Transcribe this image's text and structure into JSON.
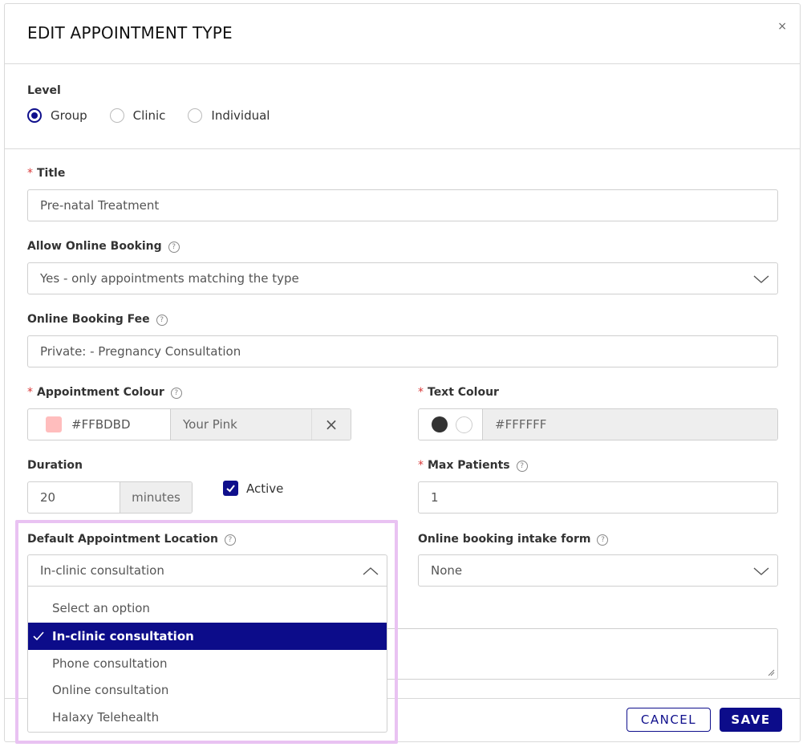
{
  "modal": {
    "title": "EDIT APPOINTMENT TYPE",
    "close": "×"
  },
  "level": {
    "label": "Level",
    "options": [
      {
        "label": "Group",
        "checked": true
      },
      {
        "label": "Clinic",
        "checked": false
      },
      {
        "label": "Individual",
        "checked": false
      }
    ]
  },
  "title_field": {
    "required": "*",
    "label": "Title",
    "value": "Pre-natal Treatment"
  },
  "online_booking": {
    "label": "Allow Online Booking",
    "value": "Yes - only appointments matching the type"
  },
  "booking_fee": {
    "label": "Online Booking Fee",
    "value": "Private:  - Pregnancy Consultation"
  },
  "appointment_colour": {
    "required": "*",
    "label": "Appointment Colour",
    "hex": "#FFBDBD",
    "name": "Your Pink",
    "clear": "×",
    "swatch": "#ffbdbd"
  },
  "text_colour": {
    "required": "*",
    "label": "Text Colour",
    "hex": "#FFFFFF",
    "dark_swatch": "#333333",
    "light_swatch": "#ffffff"
  },
  "duration": {
    "label": "Duration",
    "value": "20",
    "unit": "minutes"
  },
  "active": {
    "label": "Active",
    "checked": true
  },
  "max_patients": {
    "required": "*",
    "label": "Max Patients",
    "value": "1"
  },
  "default_location": {
    "label": "Default Appointment Location",
    "value": "In-clinic consultation",
    "options": [
      {
        "label": "Select an option",
        "selected": false
      },
      {
        "label": "In-clinic consultation",
        "selected": true
      },
      {
        "label": "Phone consultation",
        "selected": false
      },
      {
        "label": "Online consultation",
        "selected": false
      },
      {
        "label": "Halaxy Telehealth",
        "selected": false
      }
    ]
  },
  "intake_form": {
    "label": "Online booking intake form",
    "value": "None"
  },
  "footer": {
    "cancel": "CANCEL",
    "save": "SAVE"
  },
  "colors": {
    "brand": "#0c0c8a",
    "required": "#d93a3a",
    "highlight": "#e9c2f2"
  }
}
